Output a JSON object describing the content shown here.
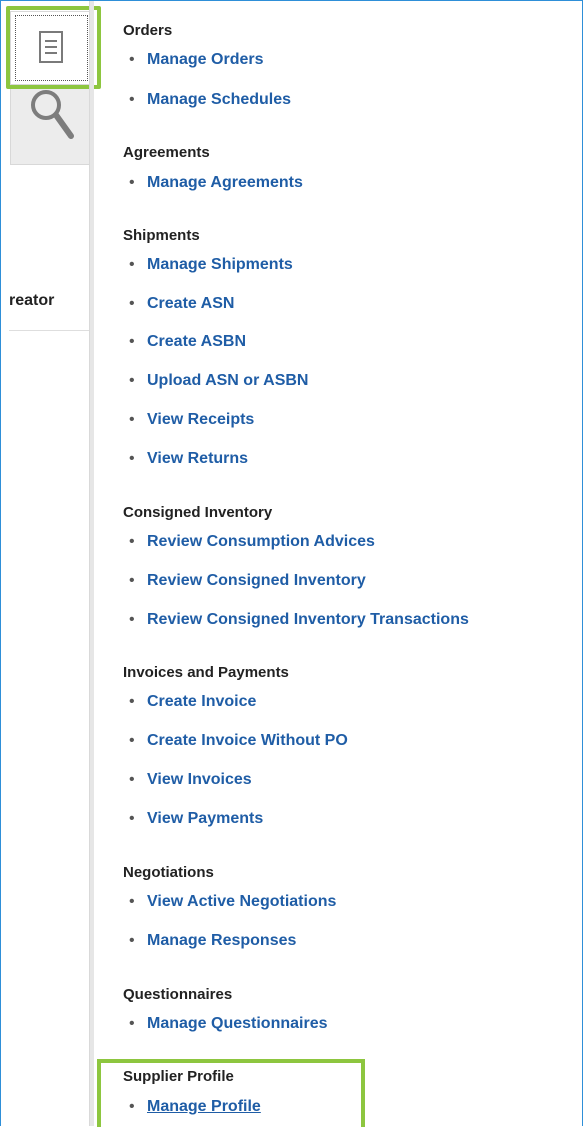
{
  "left_panel": {
    "tabs": [
      {
        "name": "tasks",
        "icon": "document-list-icon",
        "selected": true
      },
      {
        "name": "search",
        "icon": "search-icon",
        "selected": false
      }
    ],
    "label": "reator"
  },
  "colors": {
    "link": "#1f5da6",
    "heading": "#222222",
    "highlight": "#8dc63f",
    "frame": "#2e8fd8"
  },
  "sections": [
    {
      "heading": "Orders",
      "items": [
        "Manage Orders",
        "Manage Schedules"
      ]
    },
    {
      "heading": "Agreements",
      "items": [
        "Manage Agreements"
      ]
    },
    {
      "heading": "Shipments",
      "items": [
        "Manage Shipments",
        "Create ASN",
        "Create ASBN",
        "Upload ASN or ASBN",
        "View Receipts",
        "View Returns"
      ]
    },
    {
      "heading": "Consigned Inventory",
      "items": [
        "Review Consumption Advices",
        "Review Consigned Inventory",
        "Review Consigned Inventory Transactions"
      ]
    },
    {
      "heading": "Invoices and Payments",
      "items": [
        "Create Invoice",
        "Create Invoice Without PO",
        "View Invoices",
        "View Payments"
      ]
    },
    {
      "heading": "Negotiations",
      "items": [
        "View Active Negotiations",
        "Manage Responses"
      ]
    },
    {
      "heading": "Questionnaires",
      "items": [
        "Manage Questionnaires"
      ]
    },
    {
      "heading": "Supplier Profile",
      "items": [
        "Manage Profile"
      ]
    }
  ]
}
